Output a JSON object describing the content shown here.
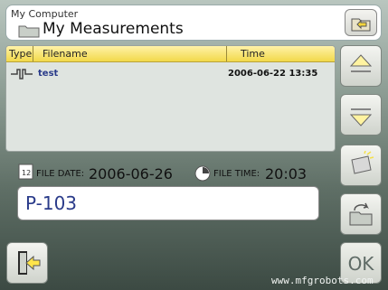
{
  "header": {
    "breadcrumb": "My Computer",
    "title": "My Measurements",
    "icons": {
      "folder": "folder-icon",
      "up_folder": "folder-up-icon"
    }
  },
  "file_list": {
    "columns": [
      "Type",
      "Filename",
      "Time"
    ],
    "rows": [
      {
        "type_icon": "measurement-signal-icon",
        "filename": "test",
        "time": "2006-06-22 13:35"
      }
    ]
  },
  "side_buttons": [
    {
      "name": "scroll-up-button",
      "icon": "chevron-up-icon"
    },
    {
      "name": "scroll-down-button",
      "icon": "chevron-down-icon"
    },
    {
      "name": "rename-button",
      "icon": "tag-icon"
    },
    {
      "name": "open-folder-button",
      "icon": "folder-open-icon"
    }
  ],
  "file_info": {
    "date_label": "FILE DATE:",
    "date_value": "2006-06-26",
    "time_label": "FILE TIME:",
    "time_value": "20:03"
  },
  "name_input": {
    "value": "P-103"
  },
  "actions": {
    "exit_icon": "exit-door-icon",
    "ok_label": "OK"
  },
  "watermark": "www.mfgrobots.com",
  "colors": {
    "header_bg": "#ffffff",
    "table_header": "#f2d94a",
    "link_blue": "#2a3b8a",
    "arrow_yellow": "#ffe44a",
    "background_dark": "#3c4a43"
  }
}
